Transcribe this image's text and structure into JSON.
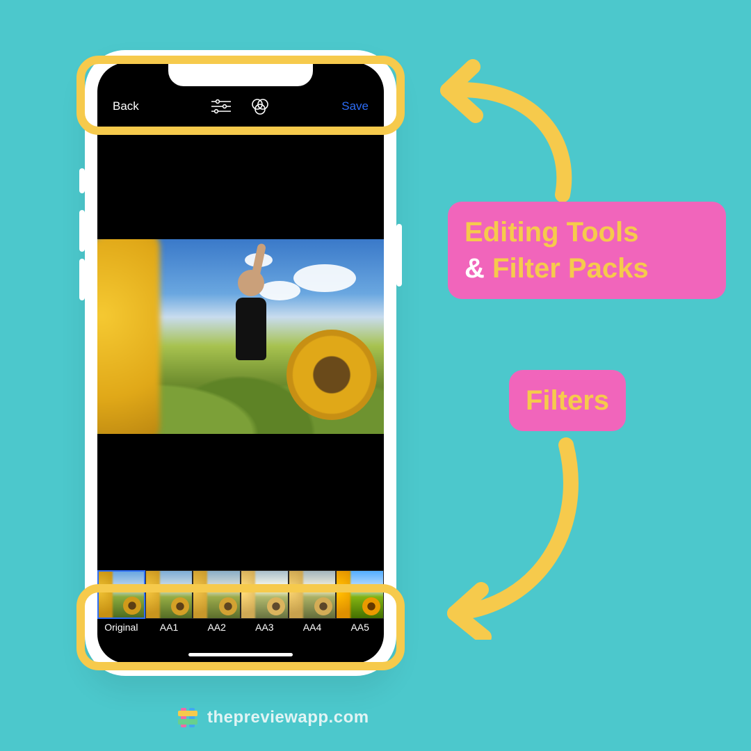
{
  "navbar": {
    "back_label": "Back",
    "save_label": "Save"
  },
  "filters": [
    {
      "label": "Original",
      "selected": true
    },
    {
      "label": "AA1",
      "selected": false
    },
    {
      "label": "AA2",
      "selected": false
    },
    {
      "label": "AA3",
      "selected": false
    },
    {
      "label": "AA4",
      "selected": false
    },
    {
      "label": "AA5",
      "selected": false
    }
  ],
  "callouts": {
    "editing_part1": "Editing Tools",
    "editing_amp": "&",
    "editing_part2": "Filter Packs",
    "filters_label": "Filters"
  },
  "footer": {
    "site": "thepreviewapp.com"
  },
  "colors": {
    "bg": "#4cc8cc",
    "accent": "#f6ca4c",
    "pink": "#f165bb",
    "link": "#2d6df6"
  }
}
